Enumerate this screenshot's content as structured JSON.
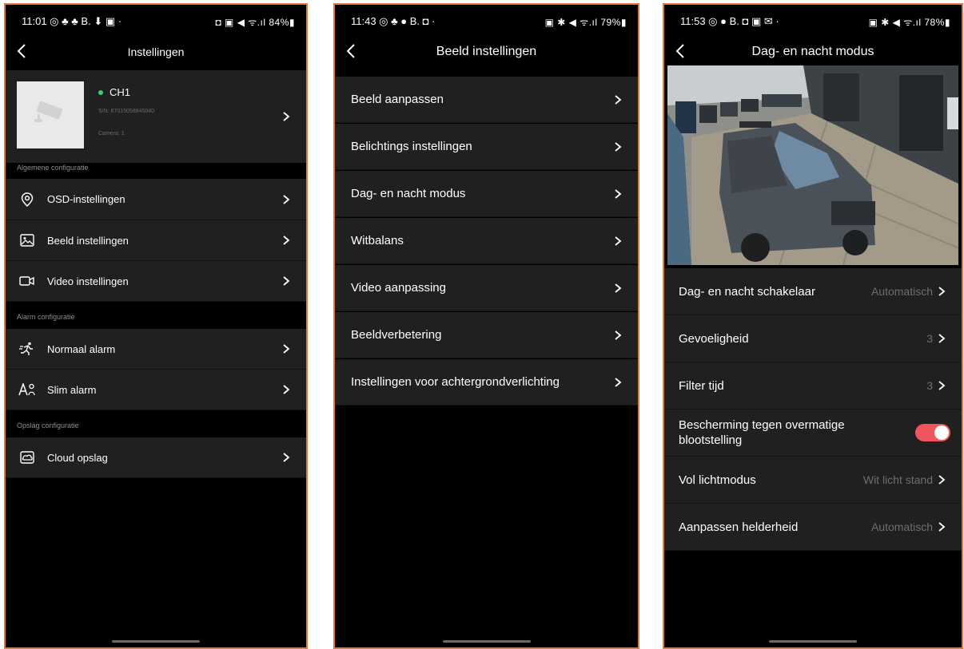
{
  "screen1": {
    "status_time": "11:01 ◎ ♣ ♣ B. ⬇ ▣ ·",
    "status_right": "◘ ▣ ◀ ᯤ.ıl 84%▮",
    "title": "Instellingen",
    "device": {
      "name": "CH1",
      "sn": "S/N: 87015058845040",
      "camera": "Camera: 1"
    },
    "sections": {
      "general": "Algemene configuratie",
      "alarm": "Alarm configuratie",
      "storage": "Opslag configuratie"
    },
    "items": {
      "osd": "OSD-instellingen",
      "image": "Beeld instellingen",
      "video": "Video instellingen",
      "normal_alarm": "Normaal alarm",
      "smart_alarm": "Slim alarm",
      "cloud": "Cloud opslag"
    }
  },
  "screen2": {
    "status_time": "11:43 ◎ ♣ ● B. ◘ ·",
    "status_right": "▣ ✱ ◀ ᯤ.ıl 79%▮",
    "title": "Beeld instellingen",
    "items": [
      "Beeld aanpassen",
      "Belichtings instellingen",
      "Dag- en nacht modus",
      "Witbalans",
      "Video aanpassing",
      "Beeldverbetering",
      "Instellingen voor achtergrondverlichting"
    ]
  },
  "screen3": {
    "status_time": "11:53 ◎ ● B. ◘ ▣ ✉ ·",
    "status_right": "▣ ✱ ◀ ᯤ.ıl 78%▮",
    "title": "Dag- en nacht modus",
    "rows": {
      "switch": {
        "label": "Dag- en nacht schakelaar",
        "value": "Automatisch"
      },
      "sensitivity": {
        "label": "Gevoeligheid",
        "value": "3"
      },
      "filter": {
        "label": "Filter tijd",
        "value": "3"
      },
      "overexposure": {
        "label": "Bescherming tegen overmatige blootstelling",
        "value": true
      },
      "full_light": {
        "label": "Vol lichtmodus",
        "value": "Wit licht stand"
      },
      "brightness": {
        "label": "Aanpassen helderheid",
        "value": "Automatisch"
      }
    },
    "toggle_on_color": "#f0555e"
  },
  "colors": {
    "frame_border": "#e07a3c",
    "row_bg": "#202020",
    "status_online": "#3ecf6a"
  }
}
